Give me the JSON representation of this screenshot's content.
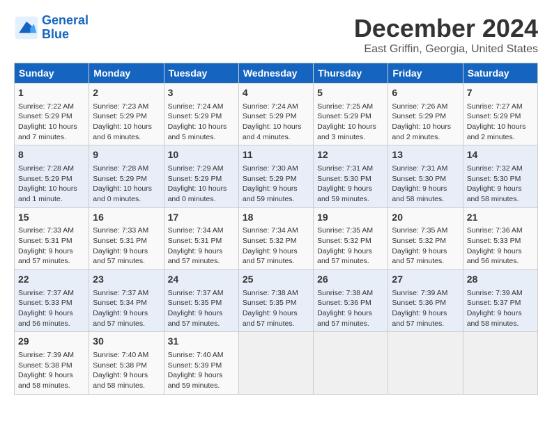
{
  "logo": {
    "line1": "General",
    "line2": "Blue"
  },
  "title": "December 2024",
  "subtitle": "East Griffin, Georgia, United States",
  "days_of_week": [
    "Sunday",
    "Monday",
    "Tuesday",
    "Wednesday",
    "Thursday",
    "Friday",
    "Saturday"
  ],
  "weeks": [
    [
      {
        "day": 1,
        "info": "Sunrise: 7:22 AM\nSunset: 5:29 PM\nDaylight: 10 hours and 7 minutes."
      },
      {
        "day": 2,
        "info": "Sunrise: 7:23 AM\nSunset: 5:29 PM\nDaylight: 10 hours and 6 minutes."
      },
      {
        "day": 3,
        "info": "Sunrise: 7:24 AM\nSunset: 5:29 PM\nDaylight: 10 hours and 5 minutes."
      },
      {
        "day": 4,
        "info": "Sunrise: 7:24 AM\nSunset: 5:29 PM\nDaylight: 10 hours and 4 minutes."
      },
      {
        "day": 5,
        "info": "Sunrise: 7:25 AM\nSunset: 5:29 PM\nDaylight: 10 hours and 3 minutes."
      },
      {
        "day": 6,
        "info": "Sunrise: 7:26 AM\nSunset: 5:29 PM\nDaylight: 10 hours and 2 minutes."
      },
      {
        "day": 7,
        "info": "Sunrise: 7:27 AM\nSunset: 5:29 PM\nDaylight: 10 hours and 2 minutes."
      }
    ],
    [
      {
        "day": 8,
        "info": "Sunrise: 7:28 AM\nSunset: 5:29 PM\nDaylight: 10 hours and 1 minute."
      },
      {
        "day": 9,
        "info": "Sunrise: 7:28 AM\nSunset: 5:29 PM\nDaylight: 10 hours and 0 minutes."
      },
      {
        "day": 10,
        "info": "Sunrise: 7:29 AM\nSunset: 5:29 PM\nDaylight: 10 hours and 0 minutes."
      },
      {
        "day": 11,
        "info": "Sunrise: 7:30 AM\nSunset: 5:29 PM\nDaylight: 9 hours and 59 minutes."
      },
      {
        "day": 12,
        "info": "Sunrise: 7:31 AM\nSunset: 5:30 PM\nDaylight: 9 hours and 59 minutes."
      },
      {
        "day": 13,
        "info": "Sunrise: 7:31 AM\nSunset: 5:30 PM\nDaylight: 9 hours and 58 minutes."
      },
      {
        "day": 14,
        "info": "Sunrise: 7:32 AM\nSunset: 5:30 PM\nDaylight: 9 hours and 58 minutes."
      }
    ],
    [
      {
        "day": 15,
        "info": "Sunrise: 7:33 AM\nSunset: 5:31 PM\nDaylight: 9 hours and 57 minutes."
      },
      {
        "day": 16,
        "info": "Sunrise: 7:33 AM\nSunset: 5:31 PM\nDaylight: 9 hours and 57 minutes."
      },
      {
        "day": 17,
        "info": "Sunrise: 7:34 AM\nSunset: 5:31 PM\nDaylight: 9 hours and 57 minutes."
      },
      {
        "day": 18,
        "info": "Sunrise: 7:34 AM\nSunset: 5:32 PM\nDaylight: 9 hours and 57 minutes."
      },
      {
        "day": 19,
        "info": "Sunrise: 7:35 AM\nSunset: 5:32 PM\nDaylight: 9 hours and 57 minutes."
      },
      {
        "day": 20,
        "info": "Sunrise: 7:35 AM\nSunset: 5:32 PM\nDaylight: 9 hours and 57 minutes."
      },
      {
        "day": 21,
        "info": "Sunrise: 7:36 AM\nSunset: 5:33 PM\nDaylight: 9 hours and 56 minutes."
      }
    ],
    [
      {
        "day": 22,
        "info": "Sunrise: 7:37 AM\nSunset: 5:33 PM\nDaylight: 9 hours and 56 minutes."
      },
      {
        "day": 23,
        "info": "Sunrise: 7:37 AM\nSunset: 5:34 PM\nDaylight: 9 hours and 57 minutes."
      },
      {
        "day": 24,
        "info": "Sunrise: 7:37 AM\nSunset: 5:35 PM\nDaylight: 9 hours and 57 minutes."
      },
      {
        "day": 25,
        "info": "Sunrise: 7:38 AM\nSunset: 5:35 PM\nDaylight: 9 hours and 57 minutes."
      },
      {
        "day": 26,
        "info": "Sunrise: 7:38 AM\nSunset: 5:36 PM\nDaylight: 9 hours and 57 minutes."
      },
      {
        "day": 27,
        "info": "Sunrise: 7:39 AM\nSunset: 5:36 PM\nDaylight: 9 hours and 57 minutes."
      },
      {
        "day": 28,
        "info": "Sunrise: 7:39 AM\nSunset: 5:37 PM\nDaylight: 9 hours and 58 minutes."
      }
    ],
    [
      {
        "day": 29,
        "info": "Sunrise: 7:39 AM\nSunset: 5:38 PM\nDaylight: 9 hours and 58 minutes."
      },
      {
        "day": 30,
        "info": "Sunrise: 7:40 AM\nSunset: 5:38 PM\nDaylight: 9 hours and 58 minutes."
      },
      {
        "day": 31,
        "info": "Sunrise: 7:40 AM\nSunset: 5:39 PM\nDaylight: 9 hours and 59 minutes."
      },
      null,
      null,
      null,
      null
    ]
  ]
}
